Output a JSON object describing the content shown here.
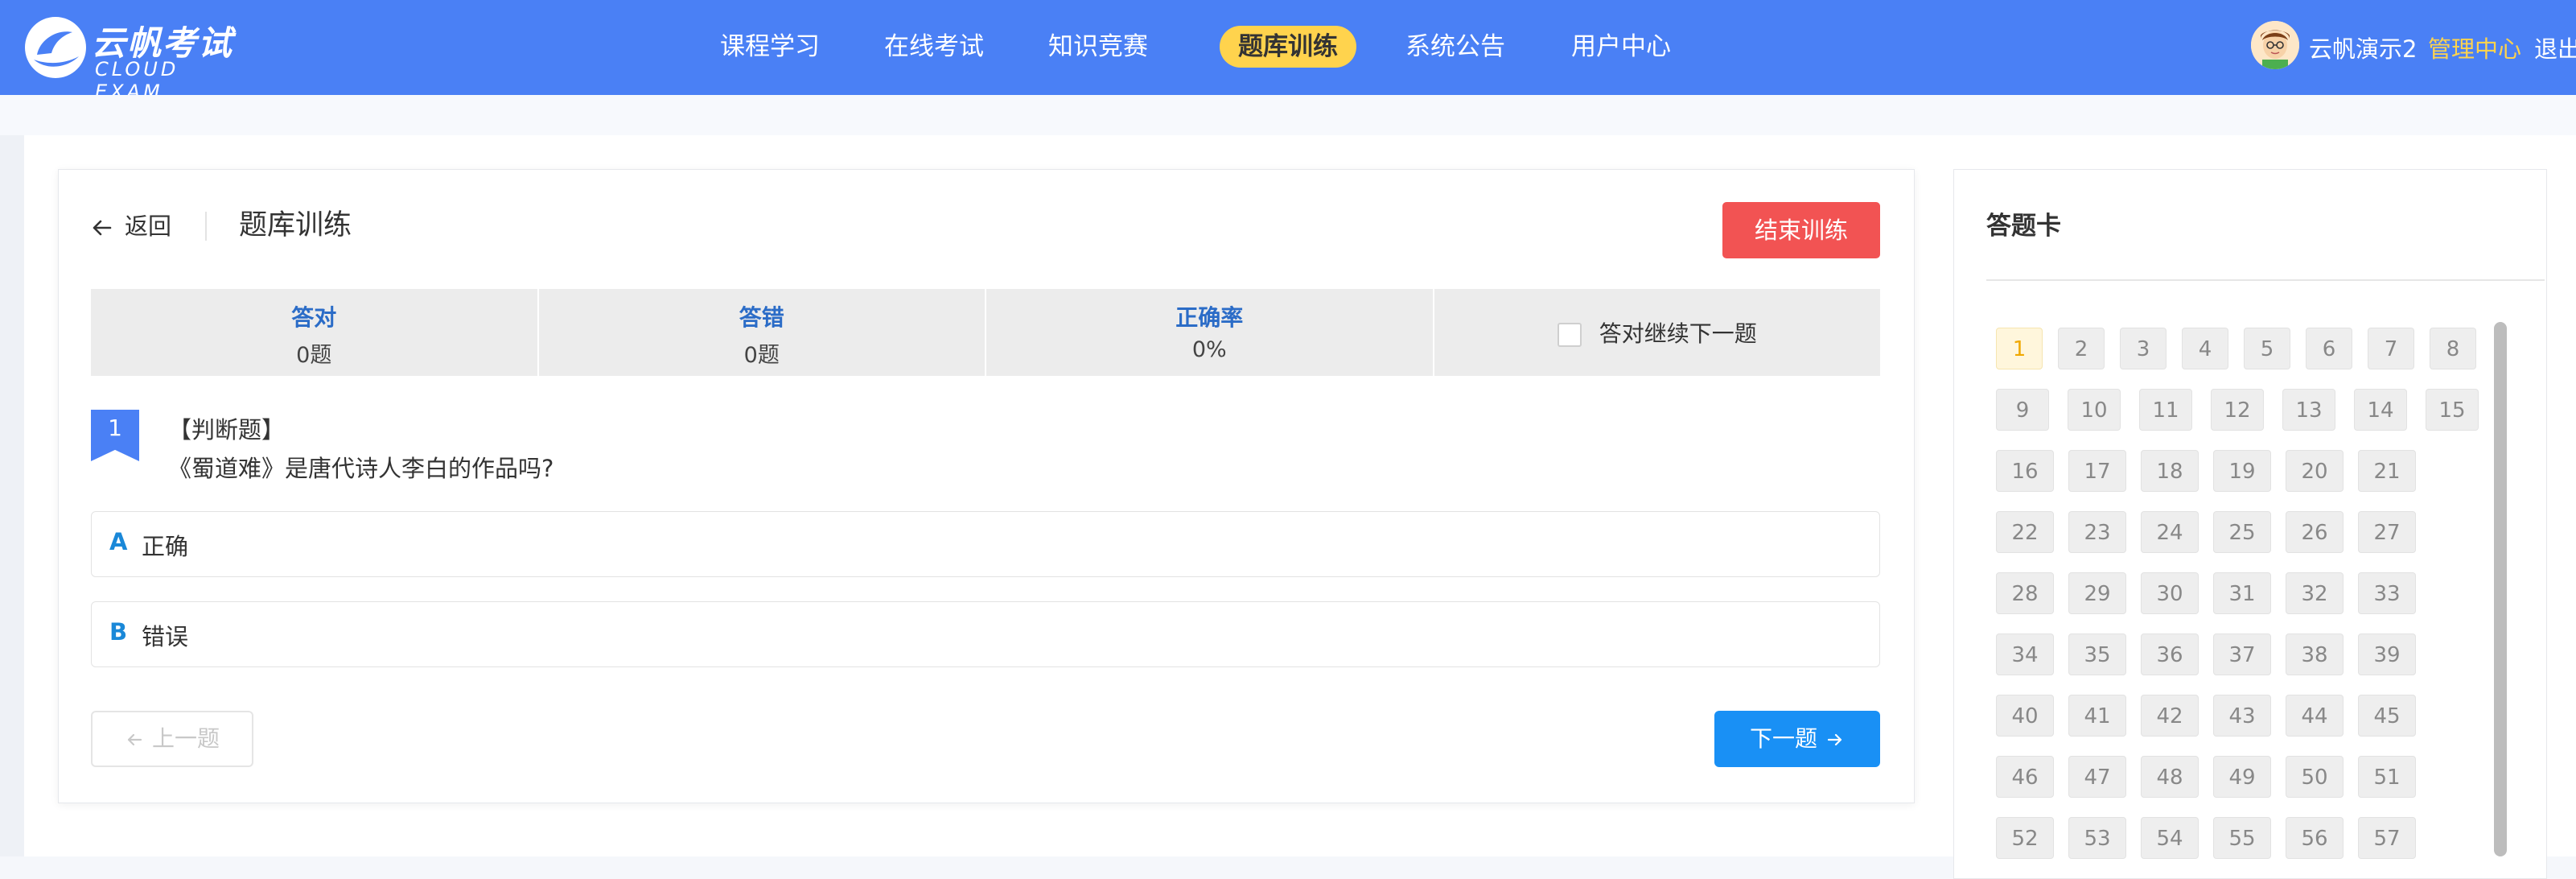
{
  "app": {
    "brand_cn": "云帆考试",
    "brand_en": "CLOUD EXAM",
    "icon": "cloud-sail-logo"
  },
  "nav": {
    "items": [
      {
        "label": "课程学习"
      },
      {
        "label": "在线考试"
      },
      {
        "label": "知识竞赛"
      },
      {
        "label": "题库训练",
        "active": true
      },
      {
        "label": "系统公告"
      },
      {
        "label": "用户中心"
      }
    ]
  },
  "user": {
    "name": "云帆演示2",
    "admin_label": "管理中心",
    "logout_label": "退出"
  },
  "page": {
    "back_label": "返回",
    "title": "题库训练",
    "end_label": "结束训练"
  },
  "stats": {
    "correct_label": "答对",
    "correct_value": "0题",
    "wrong_label": "答错",
    "wrong_value": "0题",
    "rate_label": "正确率",
    "rate_value": "0%",
    "auto_next_label": "答对继续下一题",
    "auto_next_checked": false
  },
  "question": {
    "number": "1",
    "type": "【判断题】",
    "text": "《蜀道难》是唐代诗人李白的作品吗?",
    "options": [
      {
        "key": "A",
        "text": "正确"
      },
      {
        "key": "B",
        "text": "错误"
      }
    ]
  },
  "buttons": {
    "prev_label": "上一题",
    "next_label": "下一题"
  },
  "answer_card": {
    "title": "答题卡",
    "current": 1,
    "numbers": [
      1,
      2,
      3,
      4,
      5,
      6,
      7,
      8,
      9,
      10,
      11,
      12,
      13,
      14,
      15,
      16,
      17,
      18,
      19,
      20,
      21,
      22,
      23,
      24,
      25,
      26,
      27,
      28,
      29,
      30,
      31,
      32,
      33,
      34,
      35,
      36,
      37,
      38,
      39,
      40,
      41,
      42,
      43,
      44,
      45,
      46,
      47,
      48,
      49,
      50,
      51,
      52,
      53,
      54,
      55,
      56,
      57
    ]
  },
  "colors": {
    "header": "#4a80f5",
    "nav_active": "#ffd34d",
    "danger": "#f25353",
    "primary": "#1990f5",
    "stat_label": "#2b6cc7"
  }
}
